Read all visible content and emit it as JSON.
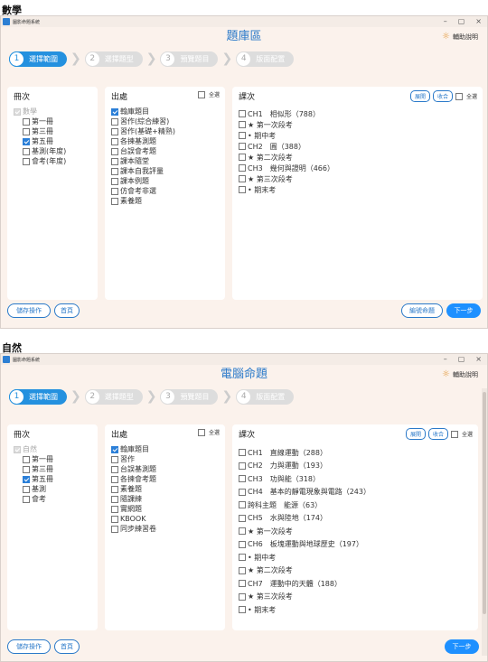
{
  "windows": [
    {
      "section_label": "數學",
      "app_title": "圖影命題系統",
      "title": "題庫區",
      "help_label": "輔助說明",
      "steps": [
        {
          "num": "1",
          "label": "選擇範圍",
          "active": true
        },
        {
          "num": "2",
          "label": "選擇題型",
          "active": false
        },
        {
          "num": "3",
          "label": "預覽題目",
          "active": false
        },
        {
          "num": "4",
          "label": "版面配置",
          "active": false
        }
      ],
      "volume": {
        "title": "冊次",
        "root": "數學",
        "items": [
          {
            "label": "第一冊",
            "checked": false
          },
          {
            "label": "第三冊",
            "checked": false
          },
          {
            "label": "第五冊",
            "checked": true
          },
          {
            "label": "基測(年度)",
            "checked": false
          },
          {
            "label": "會考(年度)",
            "checked": false
          }
        ]
      },
      "source": {
        "title": "出處",
        "select_all": "全選",
        "items": [
          {
            "label": "翰庫題目",
            "checked": true
          },
          {
            "label": "習作(綜合練習)",
            "checked": false
          },
          {
            "label": "習作(基礎+精熟)",
            "checked": false
          },
          {
            "label": "各揀基測題",
            "checked": false
          },
          {
            "label": "台誤會考題",
            "checked": false
          },
          {
            "label": "課本隨堂",
            "checked": false
          },
          {
            "label": "課本自我評量",
            "checked": false
          },
          {
            "label": "課本例題",
            "checked": false
          },
          {
            "label": "仿會考非選",
            "checked": false
          },
          {
            "label": "素養題",
            "checked": false
          }
        ]
      },
      "lessons": {
        "title": "課次",
        "expand": "展開",
        "collapse": "收合",
        "select_all": "全選",
        "items": [
          "CH1　相似形（788）",
          "★ 第一次段考",
          "• 期中考",
          "CH2　圓（388）",
          "★ 第二次段考",
          "CH3　幾何與證明（466）",
          "★ 第三次段考",
          "• 期末考"
        ]
      },
      "footer": {
        "save": "儲存操作",
        "home": "首頁",
        "numbered": "編號命題",
        "next": "下一步"
      }
    },
    {
      "section_label": "自然",
      "app_title": "圖影命題系統",
      "title": "電腦命題",
      "help_label": "輔助說明",
      "steps": [
        {
          "num": "1",
          "label": "選擇範圍",
          "active": true
        },
        {
          "num": "2",
          "label": "選擇題型",
          "active": false
        },
        {
          "num": "3",
          "label": "預覽題目",
          "active": false
        },
        {
          "num": "4",
          "label": "版面配置",
          "active": false
        }
      ],
      "volume": {
        "title": "冊次",
        "root": "自然",
        "items": [
          {
            "label": "第一冊",
            "checked": false
          },
          {
            "label": "第三冊",
            "checked": false
          },
          {
            "label": "第五冊",
            "checked": true
          },
          {
            "label": "基測",
            "checked": false
          },
          {
            "label": "會考",
            "checked": false
          }
        ]
      },
      "source": {
        "title": "出處",
        "select_all": "全選",
        "items": [
          {
            "label": "翰庫題目",
            "checked": true
          },
          {
            "label": "習作",
            "checked": false
          },
          {
            "label": "台誤基測題",
            "checked": false
          },
          {
            "label": "各揀會考題",
            "checked": false
          },
          {
            "label": "素養題",
            "checked": false
          },
          {
            "label": "隨課練",
            "checked": false
          },
          {
            "label": "實網題",
            "checked": false
          },
          {
            "label": "KBOOK",
            "checked": false
          },
          {
            "label": "同步練習卷",
            "checked": false
          }
        ]
      },
      "lessons": {
        "title": "課次",
        "expand": "展開",
        "collapse": "收合",
        "select_all": "全選",
        "items": [
          "CH1　直線運動（288）",
          "CH2　力與運動（193）",
          "CH3　功與能（318）",
          "CH4　基本的靜電現象與電路（243）",
          "跨科主題　能源（63）",
          "CH5　水與陸地（174）",
          "★ 第一次段考",
          "CH6　板塊運動與地球歷史（197）",
          "• 期中考",
          "★ 第二次段考",
          "CH7　運動中的天體（188）",
          "★ 第三次段考",
          "• 期末考"
        ]
      },
      "footer": {
        "save": "儲存操作",
        "home": "首頁",
        "next": "下一步"
      }
    }
  ]
}
